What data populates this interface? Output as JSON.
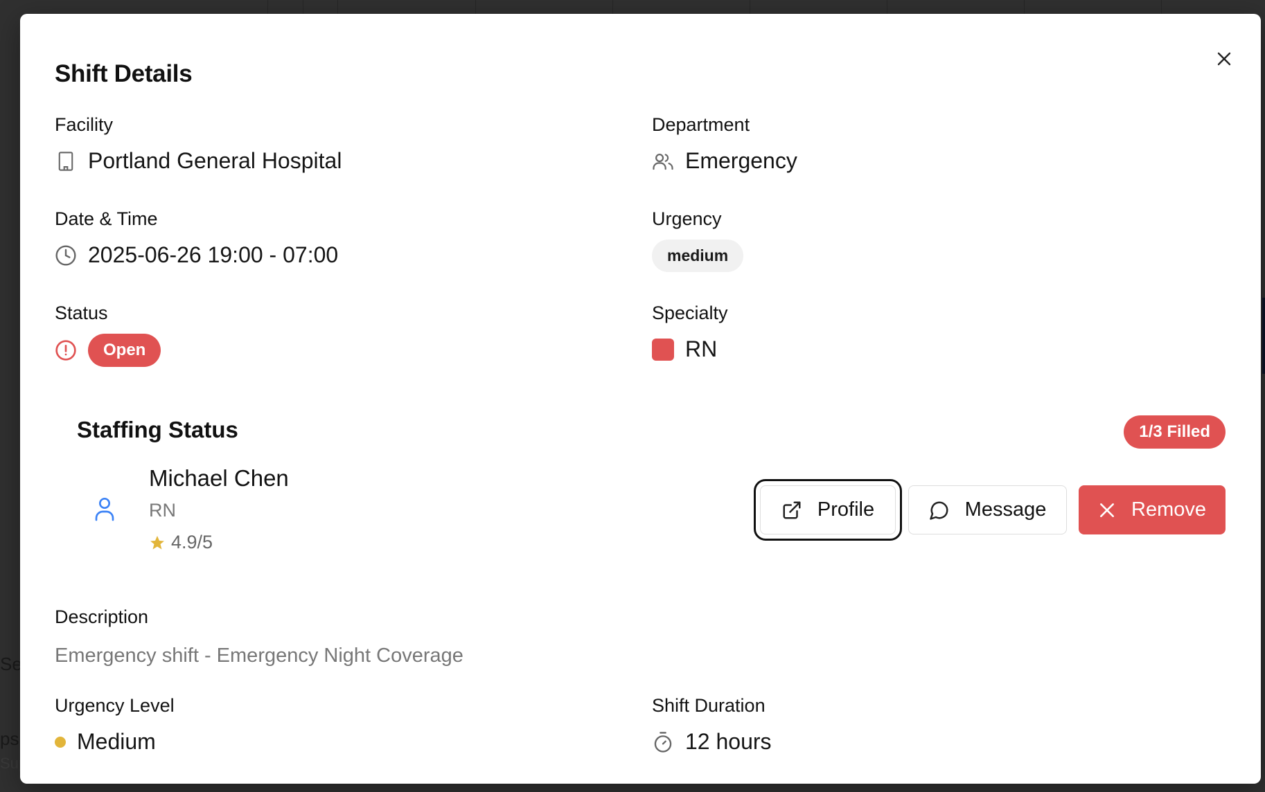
{
  "background": {
    "fragments": [
      "Set",
      "ps",
      "Sup"
    ]
  },
  "modal": {
    "title": "Shift Details",
    "close_icon": "close-icon",
    "facility": {
      "label": "Facility",
      "value": "Portland General Hospital",
      "icon": "building-icon"
    },
    "department": {
      "label": "Department",
      "value": "Emergency",
      "icon": "users-icon"
    },
    "date_time": {
      "label": "Date & Time",
      "value": "2025-06-26 19:00 - 07:00",
      "icon": "clock-icon"
    },
    "urgency": {
      "label": "Urgency",
      "value": "medium"
    },
    "status": {
      "label": "Status",
      "value": "Open",
      "icon": "alert-circle-icon",
      "color": "#e05252"
    },
    "specialty": {
      "label": "Specialty",
      "value": "RN",
      "color": "#e05252"
    },
    "staffing": {
      "title": "Staffing Status",
      "filled_badge": "1/3 Filled",
      "staff": [
        {
          "name": "Michael Chen",
          "role": "RN",
          "rating": "4.9/5",
          "icon": "user-icon",
          "actions": {
            "profile": "Profile",
            "message": "Message",
            "remove": "Remove"
          }
        }
      ]
    },
    "description": {
      "label": "Description",
      "value": "Emergency shift - Emergency Night Coverage"
    },
    "urgency_level": {
      "label": "Urgency Level",
      "value": "Medium",
      "color": "#e2b53a"
    },
    "shift_duration": {
      "label": "Shift Duration",
      "value": "12 hours",
      "icon": "timer-icon"
    }
  },
  "colors": {
    "accent_red": "#e05252",
    "person_blue": "#3b82f6",
    "star_gold": "#e2b53a"
  }
}
